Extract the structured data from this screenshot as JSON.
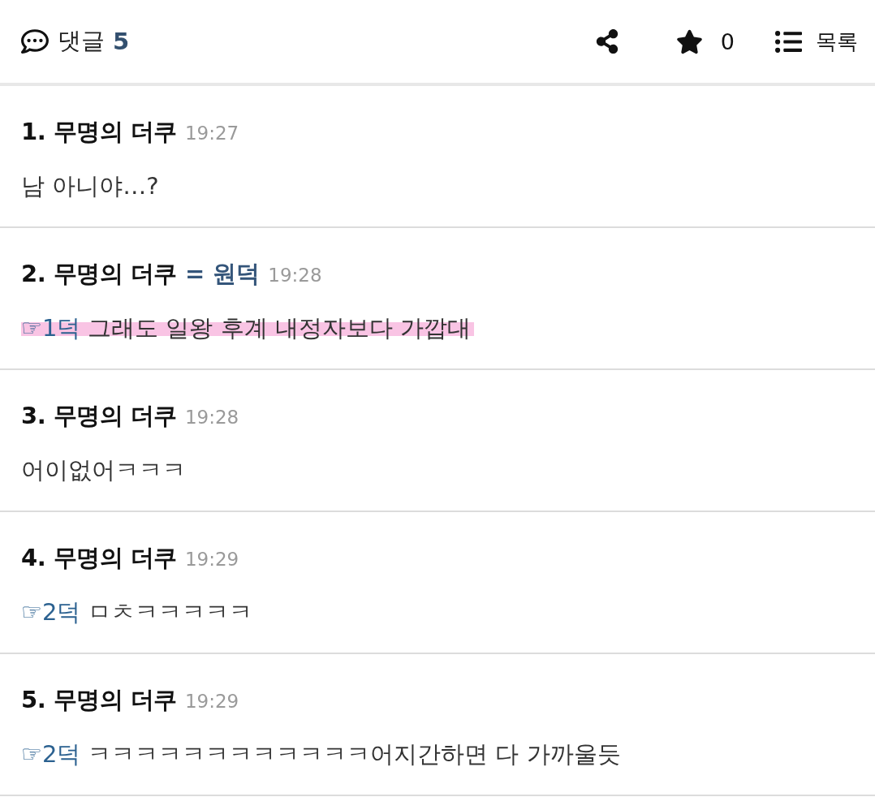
{
  "header": {
    "title": "댓글",
    "count": "5",
    "star_count": "0",
    "list_label": "목록"
  },
  "comments": [
    {
      "heading": "1. 무명의 더쿠",
      "time": "19:27",
      "body": "남 아니야…?",
      "highlighted": false
    },
    {
      "heading": "2. 무명의 더쿠",
      "nickname_tag": "= 원덕",
      "time": "19:28",
      "reply_to": "☞1덕",
      "body": "그래도 일왕 후계 내정자보다 가깝대",
      "highlighted": true
    },
    {
      "heading": "3. 무명의 더쿠",
      "time": "19:28",
      "body": "어이없어ㅋㅋㅋ",
      "highlighted": false
    },
    {
      "heading": "4. 무명의 더쿠",
      "time": "19:29",
      "reply_to": "☞2덕",
      "body": "ㅁㅊㅋㅋㅋㅋㅋ",
      "highlighted": false
    },
    {
      "heading": "5. 무명의 더쿠",
      "time": "19:29",
      "reply_to": "☞2덕",
      "body": "ㅋㅋㅋㅋㅋㅋㅋㅋㅋㅋㅋㅋ어지간하면 다 가까울듯",
      "highlighted": false
    }
  ]
}
